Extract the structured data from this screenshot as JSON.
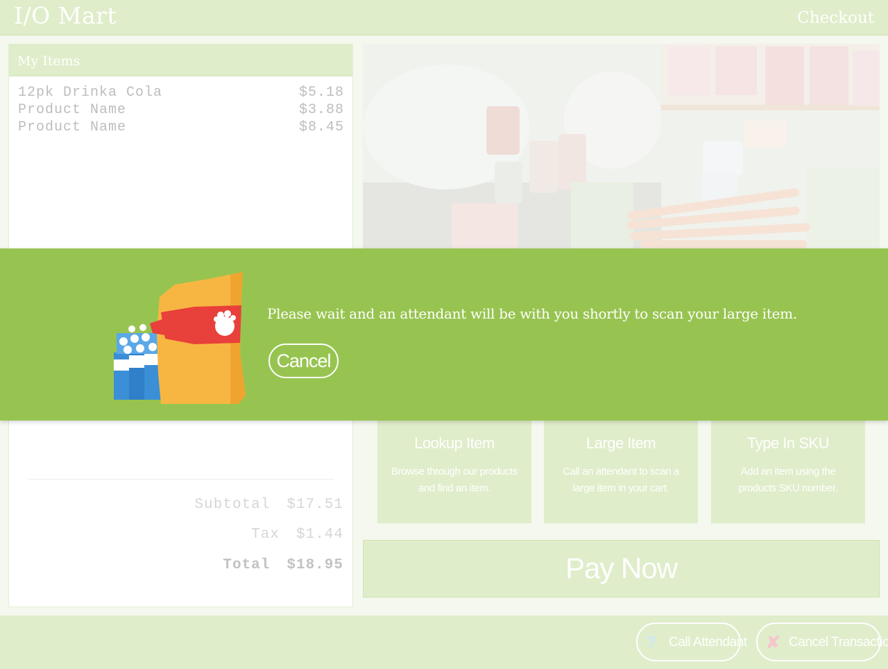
{
  "header": {
    "app_title": "I/O Mart",
    "checkout_label": "Checkout"
  },
  "items_panel": {
    "title": "My Items",
    "items": [
      {
        "name": "12pk Drinka Cola",
        "price": "$5.18"
      },
      {
        "name": "Product Name",
        "price": "$3.88"
      },
      {
        "name": "Product Name",
        "price": "$8.45"
      }
    ],
    "subtotal_label": "Subtotal",
    "subtotal_value": "$17.51",
    "tax_label": "Tax",
    "tax_value": "$1.44",
    "total_label": "Total",
    "total_value": "$18.95"
  },
  "cards": [
    {
      "title": "Lookup Item",
      "desc": "Browse through our products and find an item."
    },
    {
      "title": "Large Item",
      "desc": "Call an attendant to scan a large item in your cart."
    },
    {
      "title": "Type In SKU",
      "desc": "Add an item using the products SKU number."
    }
  ],
  "pay_now_label": "Pay Now",
  "footer": {
    "call_attendant_label": "Call Attendant",
    "call_attendant_icon": "question-icon",
    "cancel_transaction_label": "Cancel Transaction",
    "cancel_transaction_icon": "close-icon"
  },
  "modal": {
    "message": "Please wait and an attendant will be with you shortly to scan your large item.",
    "cancel_label": "Cancel",
    "illustration": "large-item-illustration"
  },
  "colors": {
    "accent_green": "#97c450",
    "pale_green": "#dfedca",
    "white": "#ffffff"
  }
}
